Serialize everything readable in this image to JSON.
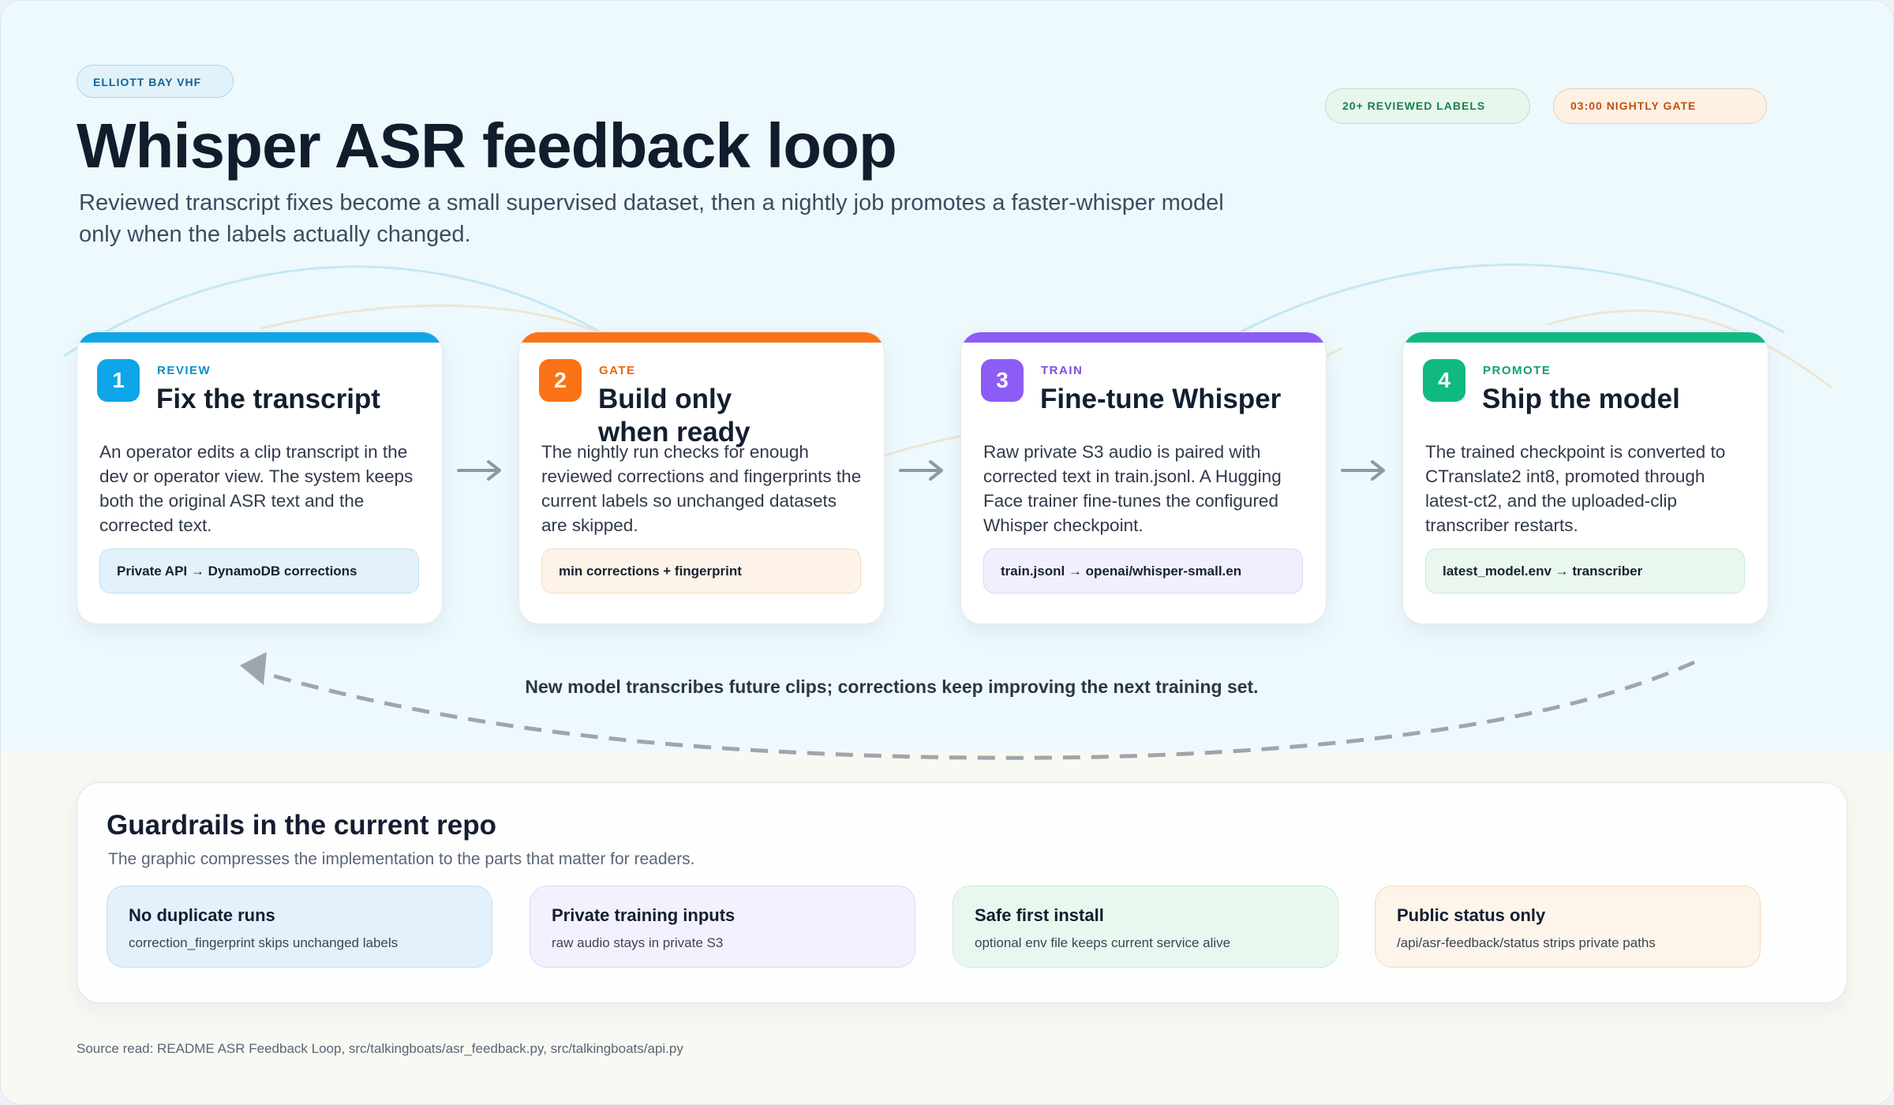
{
  "header": {
    "eyebrow": "ELLIOTT BAY VHF",
    "title": "Whisper ASR feedback loop",
    "subtitle": "Reviewed transcript fixes become a small supervised dataset, then a nightly job promotes a faster-whisper model only when the labels actually changed.",
    "pills": [
      {
        "label": "20+ REVIEWED LABELS",
        "color": "#1b7f48"
      },
      {
        "label": "03:00 NIGHTLY GATE",
        "color": "#c2500e"
      }
    ]
  },
  "steps": [
    {
      "number": "1",
      "kicker": "REVIEW",
      "title": "Fix the transcript",
      "body": "An operator edits a clip transcript in the dev or operator view. The system keeps both the original ASR text and the corrected text.",
      "chip": "Private API → DynamoDB corrections",
      "accent": "#0ea5e9"
    },
    {
      "number": "2",
      "kicker": "GATE",
      "title": "Build only when ready",
      "body": "The nightly run checks for enough reviewed corrections and fingerprints the current labels so unchanged datasets are skipped.",
      "chip": "min corrections + fingerprint",
      "accent": "#f97316"
    },
    {
      "number": "3",
      "kicker": "TRAIN",
      "title": "Fine-tune Whisper",
      "body": "Raw private S3 audio is paired with corrected text in train.jsonl. A Hugging Face trainer fine-tunes the configured Whisper checkpoint.",
      "chip": "train.jsonl → openai/whisper-small.en",
      "accent": "#8b5cf6"
    },
    {
      "number": "4",
      "kicker": "PROMOTE",
      "title": "Ship the model",
      "body": "The trained checkpoint is converted to CTranslate2 int8, promoted through latest-ct2, and the uploaded-clip transcriber restarts.",
      "chip": "latest_model.env → transcriber",
      "accent": "#10b981"
    }
  ],
  "loop_caption": "New model transcribes future clips; corrections keep improving the next training set.",
  "guardrails": {
    "title": "Guardrails in the current repo",
    "subtitle": "The graphic compresses the implementation to the parts that matter for readers.",
    "items": [
      {
        "title": "No duplicate runs",
        "desc": "correction_fingerprint skips unchanged labels"
      },
      {
        "title": "Private training inputs",
        "desc": "raw audio stays in private S3"
      },
      {
        "title": "Safe first install",
        "desc": "optional env file keeps current service alive"
      },
      {
        "title": "Public status only",
        "desc": "/api/asr-feedback/status strips private paths"
      }
    ]
  },
  "source": "Source read: README ASR Feedback Loop, src/talkingboats/asr_feedback.py, src/talkingboats/api.py"
}
